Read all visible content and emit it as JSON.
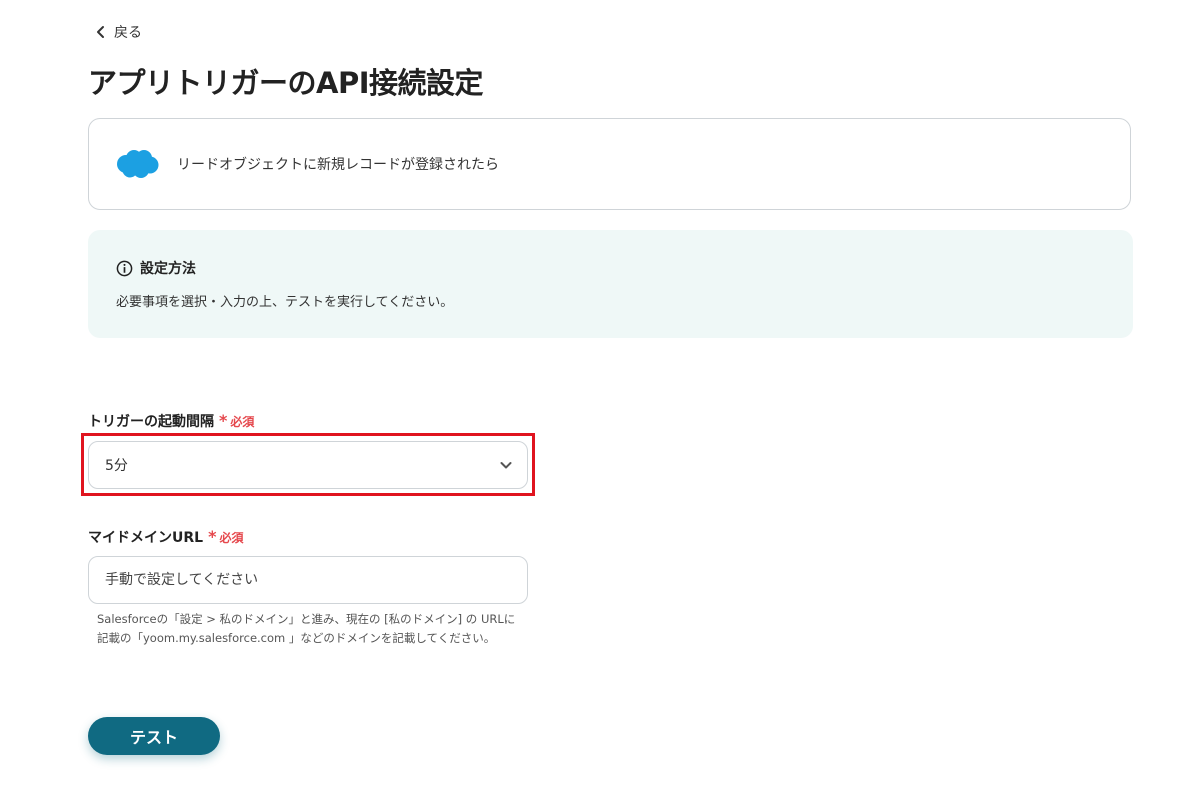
{
  "nav": {
    "back_label": "戻る"
  },
  "page": {
    "title": "アプリトリガーのAPI接続設定"
  },
  "trigger": {
    "app_icon": "salesforce-cloud-icon",
    "description": "リードオブジェクトに新規レコードが登録されたら"
  },
  "info": {
    "heading": "設定方法",
    "body": "必要事項を選択・入力の上、テストを実行してください。"
  },
  "fields": {
    "interval": {
      "label": "トリガーの起動間隔",
      "required": "必須",
      "value": "5分"
    },
    "domain": {
      "label": "マイドメインURL",
      "required": "必須",
      "placeholder": "手動で設定してください",
      "help_line1": "Salesforceの「設定 > 私のドメイン」と進み、現在の [私のドメイン] の URLに",
      "help_line2": "記載の「yoom.my.salesforce.com 」などのドメインを記載してください。"
    }
  },
  "actions": {
    "test_label": "テスト"
  },
  "colors": {
    "accent": "#106a82",
    "required": "#e5484d",
    "highlight": "#e0141f",
    "info_bg": "#eff8f7",
    "salesforce": "#1ca0e2"
  }
}
